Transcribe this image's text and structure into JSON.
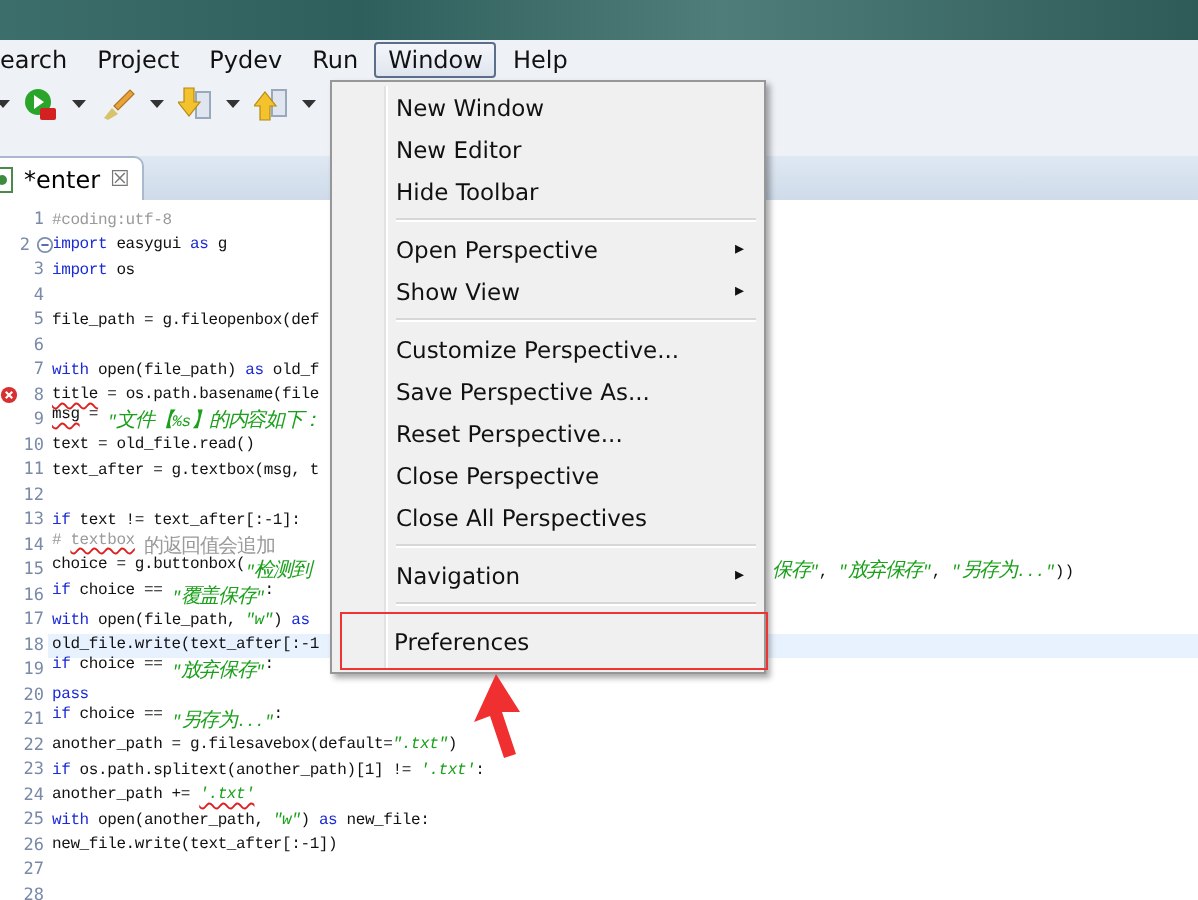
{
  "menubar": [
    {
      "label": "earch",
      "selected": false
    },
    {
      "label": "Project",
      "selected": false
    },
    {
      "label": "Pydev",
      "selected": false
    },
    {
      "label": "Run",
      "selected": false
    },
    {
      "label": "Window",
      "selected": true
    },
    {
      "label": "Help",
      "selected": false
    }
  ],
  "tab": {
    "label": "*enter",
    "close": "☒"
  },
  "editor": {
    "lines": [
      {
        "number": "1",
        "segments": [
          {
            "kind": "comment",
            "text": "#coding:utf-8"
          }
        ]
      },
      {
        "number": "2",
        "foldable": true,
        "segments": [
          {
            "kind": "keyword",
            "text": "import"
          },
          {
            "kind": "plain",
            "text": " easygui "
          },
          {
            "kind": "keyword",
            "text": "as"
          },
          {
            "kind": "plain",
            "text": " g"
          }
        ]
      },
      {
        "number": "3",
        "segments": [
          {
            "kind": "keyword",
            "text": "import"
          },
          {
            "kind": "plain",
            "text": " os"
          }
        ]
      },
      {
        "number": "4"
      },
      {
        "number": "5",
        "segments": [
          {
            "kind": "plain",
            "text": "file_path = g.fileopenbox(def"
          }
        ]
      },
      {
        "number": "6"
      },
      {
        "number": "7",
        "segments": [
          {
            "kind": "keyword",
            "text": "with"
          },
          {
            "kind": "plain",
            "text": " open(file_path) "
          },
          {
            "kind": "keyword",
            "text": "as"
          },
          {
            "kind": "plain",
            "text": " old_f"
          }
        ]
      },
      {
        "number": "8",
        "error": true,
        "segments": [
          {
            "kind": "plain",
            "text": "title",
            "squiggle": true
          },
          {
            "kind": "plain",
            "text": " = os.path.basename(file"
          }
        ]
      },
      {
        "number": "9",
        "segments": [
          {
            "kind": "plain",
            "text": "msg",
            "squiggle": true
          },
          {
            "kind": "plain",
            "text": " = "
          },
          {
            "kind": "string",
            "text": "\"文件【%s】的内容如下："
          }
        ]
      },
      {
        "number": "10",
        "segments": [
          {
            "kind": "plain",
            "text": "text = old_file.read()"
          }
        ]
      },
      {
        "number": "11",
        "segments": [
          {
            "kind": "plain",
            "text": "text_after = g.textbox(msg, t"
          }
        ]
      },
      {
        "number": "12"
      },
      {
        "number": "13",
        "segments": [
          {
            "kind": "keyword",
            "text": "if"
          },
          {
            "kind": "plain",
            "text": " text != text_after[:-1]:"
          }
        ]
      },
      {
        "number": "14",
        "segments": [
          {
            "kind": "comment",
            "text": "# "
          },
          {
            "kind": "comment",
            "text": "textbox",
            "squiggle": true
          },
          {
            "kind": "comment",
            "text": " 的返回值会追加"
          }
        ]
      },
      {
        "number": "15",
        "segments": [
          {
            "kind": "plain",
            "text": "choice = g.buttonbox("
          },
          {
            "kind": "string",
            "text": "\"检测到"
          }
        ],
        "tail": [
          {
            "kind": "string",
            "text": "保存\""
          },
          {
            "kind": "plain",
            "text": ", "
          },
          {
            "kind": "string",
            "text": "\"放弃保存\""
          },
          {
            "kind": "plain",
            "text": ", "
          },
          {
            "kind": "string",
            "text": "\"另存为...\""
          },
          {
            "kind": "plain",
            "text": "))"
          }
        ]
      },
      {
        "number": "16",
        "segments": [
          {
            "kind": "keyword",
            "text": "if"
          },
          {
            "kind": "plain",
            "text": " choice == "
          },
          {
            "kind": "string",
            "text": "\"覆盖保存\""
          },
          {
            "kind": "plain",
            "text": ":"
          }
        ]
      },
      {
        "number": "17",
        "segments": [
          {
            "kind": "keyword",
            "text": "with"
          },
          {
            "kind": "plain",
            "text": " open(file_path, "
          },
          {
            "kind": "string",
            "text": "\"w\""
          },
          {
            "kind": "plain",
            "text": ") "
          },
          {
            "kind": "keyword",
            "text": "as"
          }
        ]
      },
      {
        "number": "18",
        "current": true,
        "segments": [
          {
            "kind": "plain",
            "text": "old_file.write(text_after[:-1"
          }
        ]
      },
      {
        "number": "19",
        "segments": [
          {
            "kind": "keyword",
            "text": "if"
          },
          {
            "kind": "plain",
            "text": " choice == "
          },
          {
            "kind": "string",
            "text": "\"放弃保存\""
          },
          {
            "kind": "plain",
            "text": ":"
          }
        ]
      },
      {
        "number": "20",
        "segments": [
          {
            "kind": "keyword",
            "text": "pass"
          }
        ]
      },
      {
        "number": "21",
        "segments": [
          {
            "kind": "keyword",
            "text": "if"
          },
          {
            "kind": "plain",
            "text": " choice == "
          },
          {
            "kind": "string",
            "text": "\"另存为...\""
          },
          {
            "kind": "plain",
            "text": ":"
          }
        ]
      },
      {
        "number": "22",
        "segments": [
          {
            "kind": "plain",
            "text": "another_path = g.filesavebox(default="
          },
          {
            "kind": "string",
            "text": "\".txt\""
          },
          {
            "kind": "plain",
            "text": ")"
          }
        ]
      },
      {
        "number": "23",
        "segments": [
          {
            "kind": "keyword",
            "text": "if"
          },
          {
            "kind": "plain",
            "text": " os.path.splitext(another_path)[1] != "
          },
          {
            "kind": "string",
            "text": "'.txt'"
          },
          {
            "kind": "plain",
            "text": ":"
          }
        ]
      },
      {
        "number": "24",
        "segments": [
          {
            "kind": "plain",
            "text": "another_path += "
          },
          {
            "kind": "string",
            "text": "'.txt'",
            "squiggle": true
          }
        ]
      },
      {
        "number": "25",
        "segments": [
          {
            "kind": "keyword",
            "text": "with"
          },
          {
            "kind": "plain",
            "text": " open(another_path, "
          },
          {
            "kind": "string",
            "text": "\"w\""
          },
          {
            "kind": "plain",
            "text": ") "
          },
          {
            "kind": "keyword",
            "text": "as"
          },
          {
            "kind": "plain",
            "text": " new_file:"
          }
        ]
      },
      {
        "number": "26",
        "segments": [
          {
            "kind": "plain",
            "text": "new_file.write(text_after[:-1])"
          }
        ]
      },
      {
        "number": "27"
      },
      {
        "number": "28"
      }
    ]
  },
  "window_menu": {
    "items": [
      {
        "kind": "item",
        "label": "New Window",
        "highlighted": false
      },
      {
        "kind": "item",
        "label": "New Editor",
        "highlighted": false
      },
      {
        "kind": "item",
        "label": "Hide Toolbar",
        "highlighted": false
      },
      {
        "kind": "separator"
      },
      {
        "kind": "submenu",
        "label": "Open Perspective",
        "arrow": "▸",
        "highlighted": false
      },
      {
        "kind": "submenu",
        "label": "Show View",
        "arrow": "▸",
        "highlighted": false
      },
      {
        "kind": "separator"
      },
      {
        "kind": "item",
        "label": "Customize Perspective...",
        "highlighted": false
      },
      {
        "kind": "item",
        "label": "Save Perspective As...",
        "highlighted": false
      },
      {
        "kind": "item",
        "label": "Reset Perspective...",
        "highlighted": false
      },
      {
        "kind": "item",
        "label": "Close Perspective",
        "highlighted": false
      },
      {
        "kind": "item",
        "label": "Close All Perspectives",
        "highlighted": false
      },
      {
        "kind": "separator"
      },
      {
        "kind": "submenu",
        "label": "Navigation",
        "arrow": "▸",
        "highlighted": false
      },
      {
        "kind": "separator"
      },
      {
        "kind": "item",
        "label": "Preferences",
        "highlighted": true
      }
    ]
  }
}
